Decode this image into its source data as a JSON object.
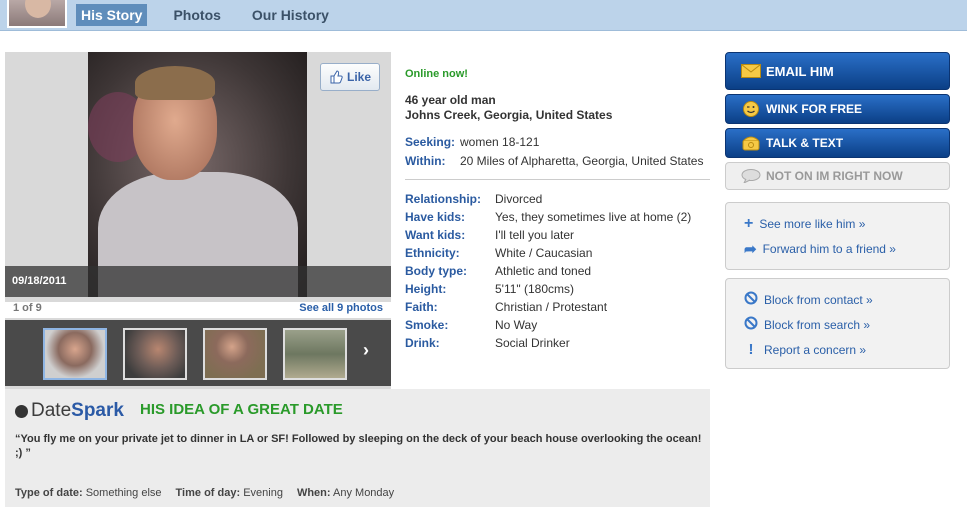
{
  "nav": {
    "tabs": [
      {
        "label": "His Story",
        "active": true
      },
      {
        "label": "Photos",
        "active": false
      },
      {
        "label": "Our History",
        "active": false
      }
    ]
  },
  "photo": {
    "date": "09/18/2011",
    "like_label": "Like",
    "count": "1 of 9",
    "see_all": "See all 9 photos"
  },
  "profile": {
    "status": "Online now!",
    "age_line": "46 year old man",
    "location": "Johns Creek, Georgia, United States",
    "seeking_label": "Seeking:",
    "seeking_value": "women 18-121",
    "within_label": "Within:",
    "within_value": "20 Miles of Alpharetta, Georgia, United States",
    "details": [
      {
        "key": "Relationship:",
        "value": "Divorced"
      },
      {
        "key": "Have kids:",
        "value": "Yes, they sometimes live at home (2)"
      },
      {
        "key": "Want kids:",
        "value": "I'll tell you later"
      },
      {
        "key": "Ethnicity:",
        "value": "White / Caucasian"
      },
      {
        "key": "Body type:",
        "value": "Athletic and toned"
      },
      {
        "key": "Height:",
        "value": "5'11\" (180cms)"
      },
      {
        "key": "Faith:",
        "value": "Christian / Protestant"
      },
      {
        "key": "Smoke:",
        "value": "No Way"
      },
      {
        "key": "Drink:",
        "value": "Social Drinker"
      }
    ]
  },
  "actions": {
    "email": "EMAIL HIM",
    "wink": "WINK FOR FREE",
    "talk": "TALK & TEXT",
    "im": "NOT ON IM RIGHT NOW"
  },
  "links1": {
    "see_more": "See more like him »",
    "forward": "Forward him to a friend »"
  },
  "links2": {
    "block_contact": "Block from contact »",
    "block_search": "Block from search »",
    "report": "Report a concern »"
  },
  "datespark": {
    "logo_date": "Date",
    "logo_spark": "Spark",
    "title": "HIS IDEA OF A GREAT DATE",
    "quote": "“You fly me on your private jet to dinner in LA or SF! Followed by sleeping on the deck of your beach house overlooking the ocean!\n;) ”",
    "type_label": "Type of date:",
    "type_value": "Something else",
    "time_label": "Time of day:",
    "time_value": "Evening",
    "when_label": "When:",
    "when_value": "Any Monday"
  },
  "colors": {
    "nav_bg": "#bcd3ea",
    "active_tab": "#5f8dbb",
    "link_blue": "#2a5fa8",
    "online_green": "#2a9a2a",
    "button_blue": "#0b3f86"
  }
}
